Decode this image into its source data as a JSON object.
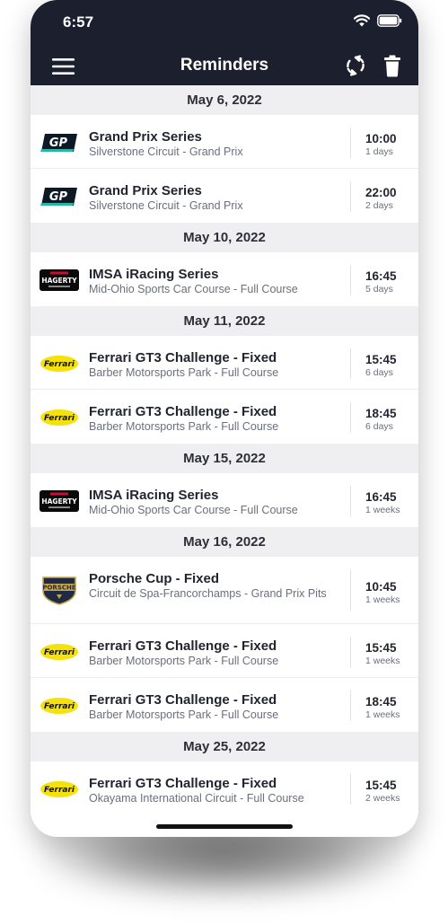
{
  "status_bar": {
    "time": "6:57"
  },
  "nav": {
    "title": "Reminders",
    "menu_icon": "hamburger-icon",
    "sync_icon": "sync-icon",
    "trash_icon": "trash-icon"
  },
  "colors": {
    "header_bg": "#1c1f2e",
    "section_bg": "#efeff1"
  },
  "sections": [
    {
      "date": "May 6, 2022",
      "items": [
        {
          "logo": "grand-prix-logo",
          "title": "Grand Prix Series",
          "track": "Silverstone Circuit - Grand Prix",
          "time": "10:00",
          "until": "1 days"
        },
        {
          "logo": "grand-prix-logo",
          "title": "Grand Prix Series",
          "track": "Silverstone Circuit - Grand Prix",
          "time": "22:00",
          "until": "2 days"
        }
      ]
    },
    {
      "date": "May 10, 2022",
      "items": [
        {
          "logo": "imsa-hagerty-logo",
          "title": "IMSA iRacing Series",
          "track": "Mid-Ohio Sports Car Course - Full Course",
          "time": "16:45",
          "until": "5 days"
        }
      ]
    },
    {
      "date": "May 11, 2022",
      "items": [
        {
          "logo": "ferrari-logo",
          "title": "Ferrari GT3 Challenge - Fixed",
          "track": "Barber Motorsports Park - Full Course",
          "time": "15:45",
          "until": "6 days"
        },
        {
          "logo": "ferrari-logo",
          "title": "Ferrari GT3 Challenge - Fixed",
          "track": "Barber Motorsports Park - Full Course",
          "time": "18:45",
          "until": "6 days"
        }
      ]
    },
    {
      "date": "May 15, 2022",
      "items": [
        {
          "logo": "imsa-hagerty-logo",
          "title": "IMSA iRacing Series",
          "track": "Mid-Ohio Sports Car Course - Full Course",
          "time": "16:45",
          "until": "1 weeks"
        }
      ]
    },
    {
      "date": "May 16, 2022",
      "items": [
        {
          "logo": "porsche-logo",
          "title": "Porsche Cup - Fixed",
          "track": "Circuit de Spa-Francorchamps - Grand Prix Pits",
          "time": "10:45",
          "until": "1 weeks"
        },
        {
          "logo": "ferrari-logo",
          "title": "Ferrari GT3 Challenge - Fixed",
          "track": "Barber Motorsports Park - Full Course",
          "time": "15:45",
          "until": "1 weeks"
        },
        {
          "logo": "ferrari-logo",
          "title": "Ferrari GT3 Challenge - Fixed",
          "track": "Barber Motorsports Park - Full Course",
          "time": "18:45",
          "until": "1 weeks"
        }
      ]
    },
    {
      "date": "May 25, 2022",
      "items": [
        {
          "logo": "ferrari-logo",
          "title": "Ferrari GT3 Challenge - Fixed",
          "track": "Okayama International Circuit - Full Course",
          "time": "15:45",
          "until": "2 weeks"
        }
      ]
    }
  ]
}
